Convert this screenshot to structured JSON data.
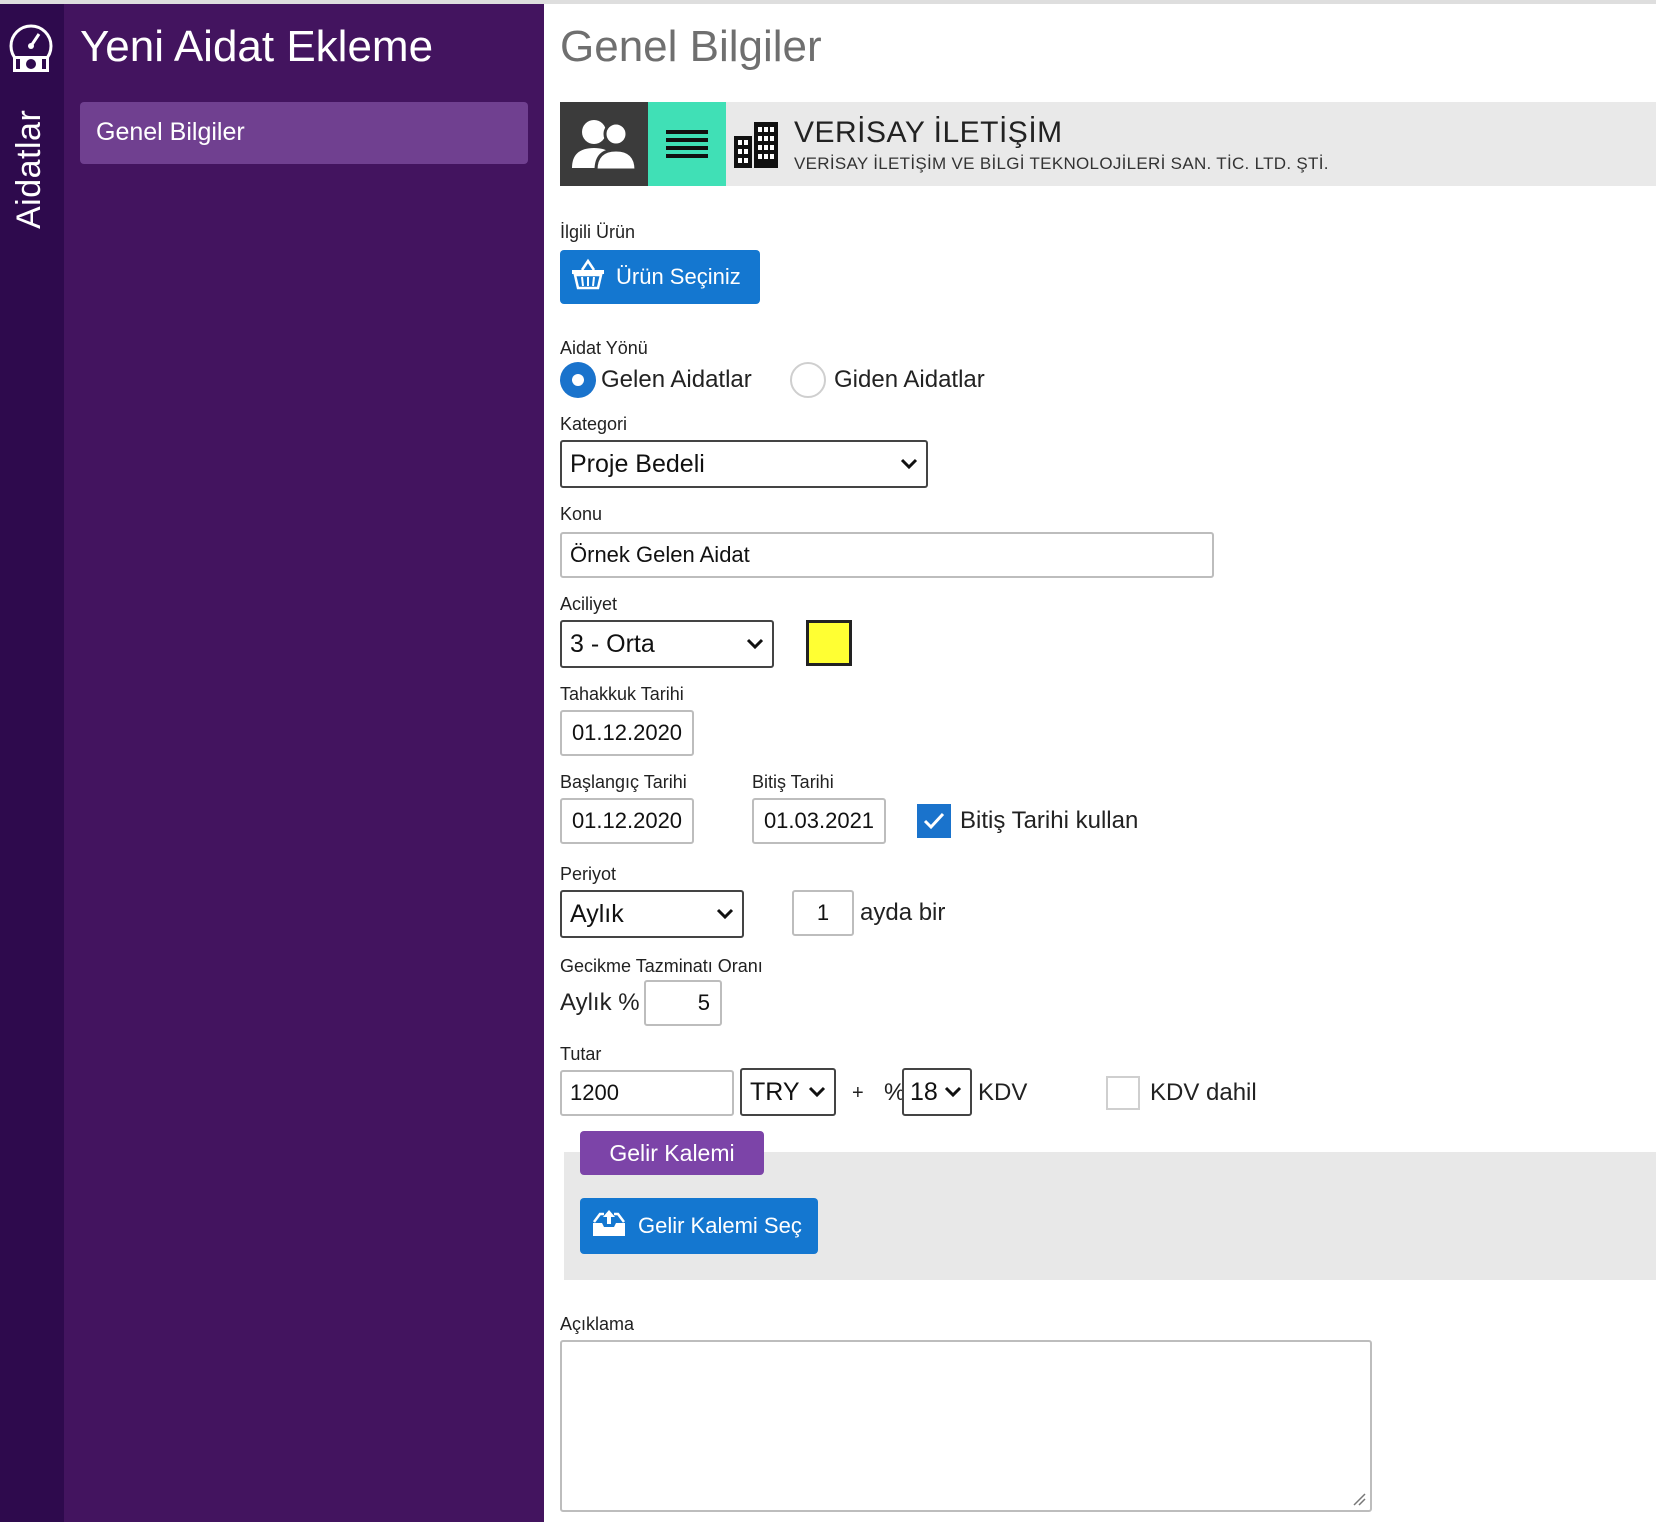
{
  "rail": {
    "title": "Aidatlar",
    "icon": "money-gauge-icon"
  },
  "sidebar": {
    "heading": "Yeni Aidat Ekleme",
    "items": [
      {
        "label": "Genel Bilgiler"
      }
    ]
  },
  "main": {
    "title": "Genel Bilgiler",
    "company": {
      "name": "VERİSAY İLETİŞİM",
      "full_name": "VERİSAY İLETİŞİM VE BİLGİ TEKNOLOJİLERİ SAN. TİC. LTD. ŞTİ.",
      "icons": [
        "people-icon",
        "menu-icon",
        "building-icon"
      ],
      "colors": {
        "people_bg": "#3b3b3b",
        "menu_bg": "#40e0b6"
      }
    },
    "product": {
      "label": "İlgili Ürün",
      "button": "Ürün Seçiniz"
    },
    "direction": {
      "label": "Aidat Yönü",
      "options": [
        {
          "label": "Gelen Aidatlar",
          "selected": true
        },
        {
          "label": "Giden Aidatlar",
          "selected": false
        }
      ]
    },
    "category": {
      "label": "Kategori",
      "value": "Proje Bedeli"
    },
    "subject": {
      "label": "Konu",
      "value": "Örnek Gelen Aidat"
    },
    "urgency": {
      "label": "Aciliyet",
      "value": "3 - Orta",
      "color": "#ffff33"
    },
    "accrual_date": {
      "label": "Tahakkuk Tarihi",
      "value": "01.12.2020"
    },
    "start_date": {
      "label": "Başlangıç Tarihi",
      "value": "01.12.2020"
    },
    "end_date": {
      "label": "Bitiş Tarihi",
      "value": "01.03.2021"
    },
    "use_end_date": {
      "label": "Bitiş Tarihi kullan",
      "checked": true
    },
    "period": {
      "label": "Periyot",
      "value": "Aylık",
      "count": "1",
      "suffix": "ayda bir"
    },
    "late_fee": {
      "label": "Gecikme Tazminatı Oranı",
      "prefix": "Aylık %",
      "value": "5"
    },
    "amount": {
      "label": "Tutar",
      "value": "1200",
      "currency": "TRY",
      "plus": "+",
      "percent_sign": "%",
      "vat_rate": "18",
      "vat_label": "KDV",
      "vat_included_label": "KDV dahil",
      "vat_included": false
    },
    "income": {
      "tab": "Gelir Kalemi",
      "button": "Gelir Kalemi Seç"
    },
    "description": {
      "label": "Açıklama",
      "value": ""
    },
    "colors": {
      "primary": "#1477d0",
      "accent_purple": "#7c44a8",
      "sidebar": "#43145f",
      "rail": "#2e0a4d"
    }
  }
}
